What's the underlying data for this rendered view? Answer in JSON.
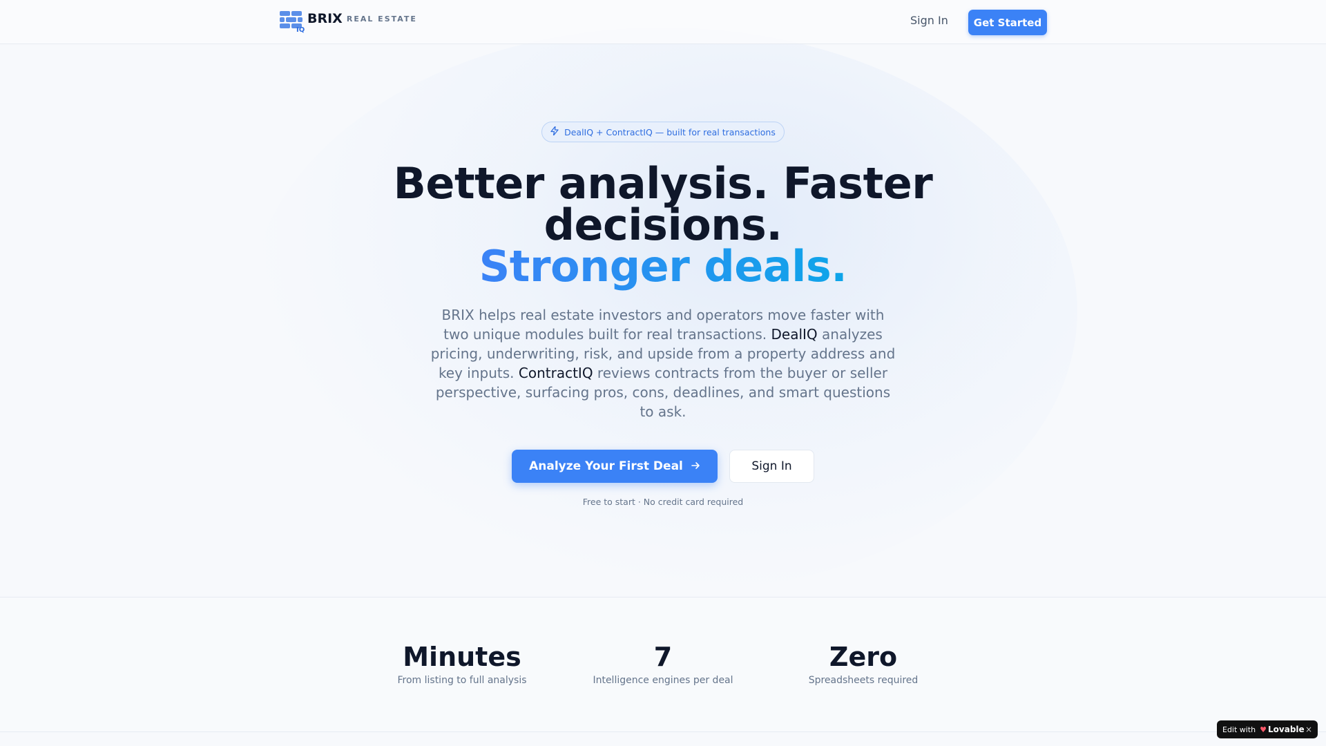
{
  "colors": {
    "accent": "#3b82f6",
    "accent_end": "#0ea5e9",
    "text": "#0f172a",
    "muted": "#64748b"
  },
  "header": {
    "brand": "BRIX",
    "brand_sub": "REAL ESTATE",
    "logo_mark_text": "IQ",
    "sign_in": "Sign In",
    "get_started": "Get Started"
  },
  "hero": {
    "badge": "DealIQ + ContractIQ — built for real transactions",
    "badge_icon": "bolt-icon",
    "title_line1": "Better analysis. Faster",
    "title_line2": "decisions.",
    "title_accent": "Stronger deals.",
    "desc_part1": "BRIX helps real estate investors and operators move faster with two unique modules built for real transactions. ",
    "desc_hl1": "DealIQ",
    "desc_part2": " analyzes pricing, underwriting, risk, and upside from a property address and key inputs. ",
    "desc_hl2": "ContractIQ",
    "desc_part3": " reviews contracts from the buyer or seller perspective, surfacing pros, cons, deadlines, and smart questions to ask.",
    "cta_primary": "Analyze Your First Deal",
    "cta_primary_icon": "arrow-right-icon",
    "cta_secondary": "Sign In",
    "fineprint": "Free to start · No credit card required"
  },
  "stats": [
    {
      "value": "Minutes",
      "label": "From listing to full analysis"
    },
    {
      "value": "7",
      "label": "Intelligence engines per deal"
    },
    {
      "value": "Zero",
      "label": "Spreadsheets required"
    }
  ],
  "lovable": {
    "prefix": "Edit with",
    "brand": "Lovable",
    "close": "×"
  }
}
